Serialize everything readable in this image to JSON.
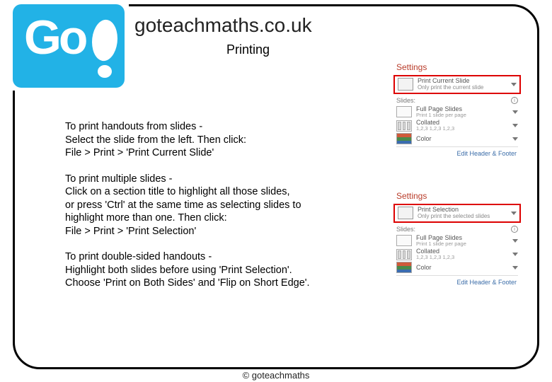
{
  "logo": {
    "text": "Go"
  },
  "header": {
    "site": "goteachmaths.co.uk",
    "page_title": "Printing"
  },
  "instructions": {
    "p1a": "To print handouts from slides -",
    "p1b": "Select the slide from the left. Then click:",
    "p1c": "File > Print > 'Print Current Slide'",
    "p2a": "To print multiple slides -",
    "p2b": "Click on a section title to highlight all those slides,",
    "p2c": "or press 'Ctrl' at the same time as selecting slides to",
    "p2d": "highlight more than one. Then click:",
    "p2e": "File > Print > 'Print Selection'",
    "p3a": "To print double-sided handouts -",
    "p3b": "Highlight both slides before using 'Print Selection'.",
    "p3c": "Choose 'Print on Both Sides' and 'Flip on Short Edge'."
  },
  "panel1": {
    "header": "Settings",
    "main_l1": "Print Current Slide",
    "main_l2": "Only print the current slide",
    "slides_label": "Slides:",
    "opt_fps_l1": "Full Page Slides",
    "opt_fps_l2": "Print 1 slide per page",
    "opt_col_l1": "Collated",
    "opt_col_l2": "1,2,3   1,2,3   1,2,3",
    "opt_color": "Color",
    "edit": "Edit Header & Footer"
  },
  "panel2": {
    "header": "Settings",
    "main_l1": "Print Selection",
    "main_l2": "Only print the selected slides",
    "slides_label": "Slides:",
    "opt_fps_l1": "Full Page Slides",
    "opt_fps_l2": "Print 1 slide per page",
    "opt_col_l1": "Collated",
    "opt_col_l2": "1,2,3   1,2,3   1,2,3",
    "opt_color": "Color",
    "edit": "Edit Header & Footer"
  },
  "footer": "© goteachmaths"
}
